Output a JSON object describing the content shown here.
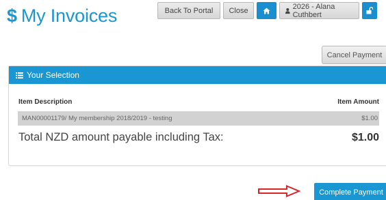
{
  "header": {
    "title_symbol": "$",
    "title": "My Invoices",
    "back_label": "Back To Portal",
    "close_label": "Close",
    "user_label": "2026 - Alana Cuthbert"
  },
  "actions": {
    "cancel_label": "Cancel Payment",
    "complete_label": "Complete Payment"
  },
  "selection": {
    "heading": "Your Selection",
    "col_description": "Item Description",
    "col_amount": "Item Amount",
    "items": [
      {
        "description": "MAN00001179/ My membership 2018/2019 - testing",
        "amount": "$1.00"
      }
    ],
    "total_label": "Total NZD amount payable including Tax:",
    "total_amount": "$1.00"
  },
  "colors": {
    "brand_blue": "#1a96d3",
    "arrow_red": "#d9242a"
  },
  "icons": [
    "home-icon",
    "user-icon",
    "unlock-icon",
    "list-icon",
    "arrow-right-icon"
  ]
}
